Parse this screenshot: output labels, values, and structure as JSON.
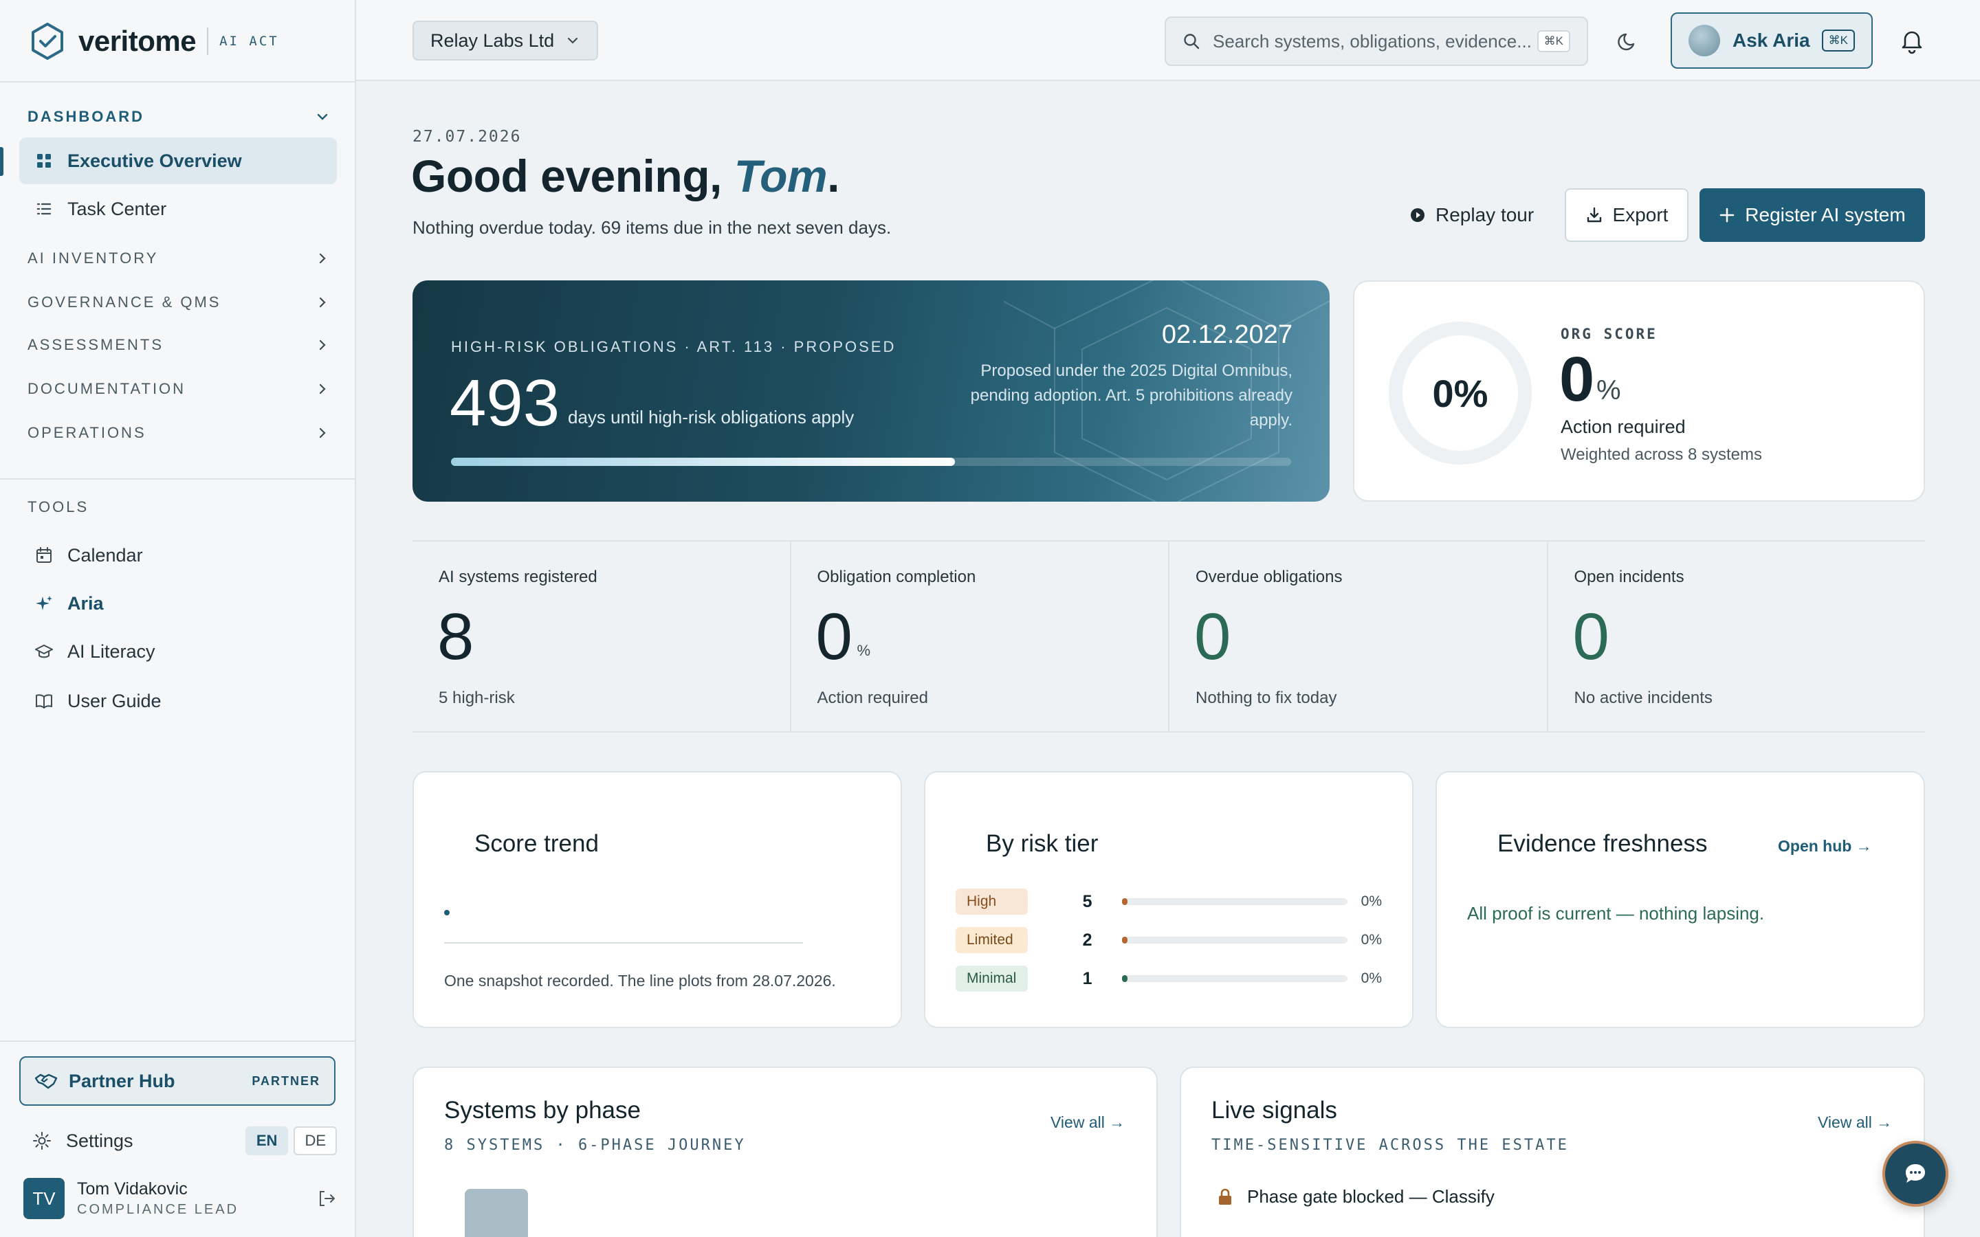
{
  "brand": {
    "name": "veritome",
    "tag": "AI ACT"
  },
  "sidebar": {
    "dashboard_label": "DASHBOARD",
    "dashboard_items": [
      {
        "label": "Executive Overview",
        "icon": "grid-icon"
      },
      {
        "label": "Task Center",
        "icon": "list-icon"
      }
    ],
    "sections": [
      "AI INVENTORY",
      "GOVERNANCE & QMS",
      "ASSESSMENTS",
      "DOCUMENTATION",
      "OPERATIONS"
    ],
    "tools_label": "TOOLS",
    "tools": [
      {
        "label": "Calendar",
        "icon": "calendar-icon"
      },
      {
        "label": "Aria",
        "icon": "sparkle-icon"
      },
      {
        "label": "AI Literacy",
        "icon": "graduation-cap-icon"
      },
      {
        "label": "User Guide",
        "icon": "book-icon"
      }
    ],
    "partner": {
      "label": "Partner Hub",
      "tag": "PARTNER"
    },
    "settings_label": "Settings",
    "languages": [
      "EN",
      "DE"
    ],
    "active_language": "EN",
    "user": {
      "initials": "TV",
      "name": "Tom Vidakovic",
      "role": "COMPLIANCE LEAD"
    }
  },
  "header": {
    "org": "Relay Labs Ltd",
    "search_placeholder": "Search systems, obligations, evidence...",
    "search_shortcut": "⌘K",
    "ask_label": "Ask Aria",
    "ask_shortcut": "⌘K"
  },
  "greeting": {
    "date": "27.07.2026",
    "hello": "Good evening, ",
    "name": "Tom",
    "period": ".",
    "summary": "Nothing overdue today. 69 items due in the next seven days."
  },
  "actions": {
    "tour": "Replay tour",
    "export": "Export",
    "register": "Register AI system"
  },
  "countdown": {
    "kicker": "HIGH-RISK OBLIGATIONS · ART. 113 · PROPOSED",
    "days": "493",
    "unit": "days until high-risk obligations apply",
    "deadline": "02.12.2027",
    "note": "Proposed under the 2025 Digital Omnibus, pending adoption. Art. 5 prohibitions already apply.",
    "progress": 0.6
  },
  "org_score": {
    "ring_label": "0%",
    "kicker": "ORG SCORE",
    "value": "0",
    "unit": "%",
    "status": "Action required",
    "note": "Weighted across 8 systems",
    "score": 0
  },
  "kpis": [
    {
      "label": "AI systems registered",
      "value": "8",
      "unit": "",
      "note": "5 high-risk",
      "tone": "default"
    },
    {
      "label": "Obligation completion",
      "value": "0",
      "unit": "%",
      "note": "Action required",
      "tone": "default"
    },
    {
      "label": "Overdue obligations",
      "value": "0",
      "unit": "",
      "note": "Nothing to fix today",
      "tone": "good"
    },
    {
      "label": "Open incidents",
      "value": "0",
      "unit": "",
      "note": "No active incidents",
      "tone": "good"
    }
  ],
  "score_trend": {
    "title": "Score trend",
    "note": "One snapshot recorded. The line plots from 28.07.2026."
  },
  "risk_tier": {
    "title": "By risk tier",
    "rows": [
      {
        "label": "High",
        "count": "5",
        "pct": "0%",
        "pct_value": 0,
        "bg": "#f8e7d6",
        "fg": "#8a4b1b",
        "dot": "#b5682e"
      },
      {
        "label": "Limited",
        "count": "2",
        "pct": "0%",
        "pct_value": 0,
        "bg": "#fbe9d2",
        "fg": "#7a4a15",
        "dot": "#b5682e"
      },
      {
        "label": "Minimal",
        "count": "1",
        "pct": "0%",
        "pct_value": 0,
        "bg": "#e3efe9",
        "fg": "#2b5a45",
        "dot": "#2b6b55"
      }
    ]
  },
  "evidence": {
    "title": "Evidence freshness",
    "link": "Open hub →",
    "note": "All proof is current — nothing lapsing."
  },
  "phases": {
    "title": "Systems by phase",
    "subtitle": "8 SYSTEMS · 6-PHASE JOURNEY",
    "link": "View all →"
  },
  "signals": {
    "title": "Live signals",
    "subtitle": "TIME-SENSITIVE ACROSS THE ESTATE",
    "link": "View all →",
    "items": [
      {
        "label": "Phase gate blocked — Classify",
        "icon": "lock-icon"
      }
    ]
  },
  "colors": {
    "accent": "#1f5c78",
    "good": "#2b6b55",
    "warning": "#b5682e"
  }
}
